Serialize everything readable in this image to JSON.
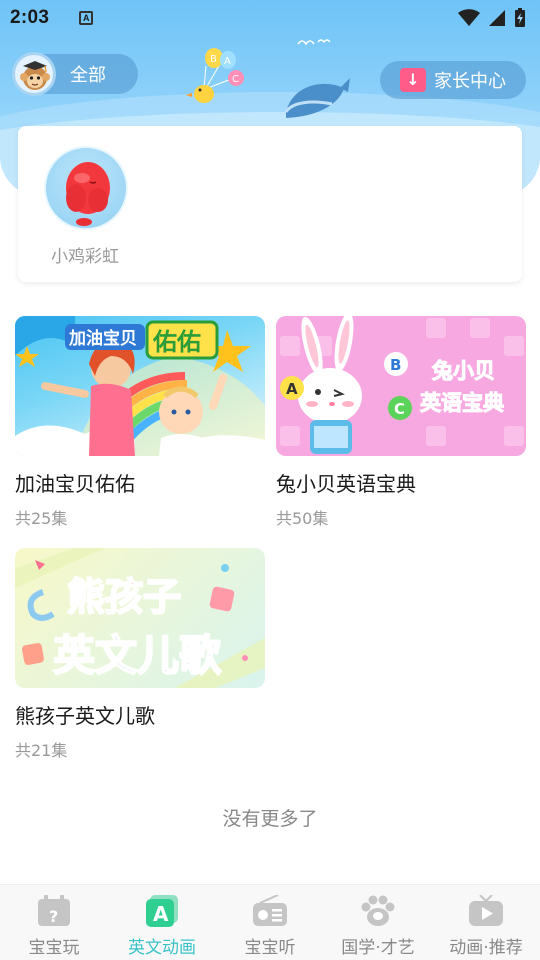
{
  "status_bar": {
    "time": "2:03"
  },
  "header": {
    "filter_label": "全部",
    "parent_center_label": "家长中心"
  },
  "characters": [
    {
      "label": "小鸡彩虹"
    }
  ],
  "shows": [
    {
      "title": "加油宝贝佑佑",
      "count": "共25集",
      "thumb_text_1": "加油宝贝",
      "thumb_text_2": "佑佑"
    },
    {
      "title": "兔小贝英语宝典",
      "count": "共50集",
      "thumb_text_1": "兔小贝",
      "thumb_text_2": "英语宝典"
    },
    {
      "title": "熊孩子英文儿歌",
      "count": "共21集",
      "thumb_text_1": "熊孩子",
      "thumb_text_2": "英文儿歌"
    }
  ],
  "footer_text": "没有更多了",
  "bottom_nav": [
    {
      "label": "宝宝玩",
      "icon": "calendar-question-icon",
      "active": false
    },
    {
      "label": "英文动画",
      "icon": "letter-a-icon",
      "active": true
    },
    {
      "label": "宝宝听",
      "icon": "radio-icon",
      "active": false
    },
    {
      "label": "国学·才艺",
      "icon": "paw-icon",
      "active": false
    },
    {
      "label": "动画·推荐",
      "icon": "tv-play-icon",
      "active": false
    }
  ],
  "colors": {
    "accent": "#39c3c9",
    "sky": "#6fc3f7",
    "download_badge": "#ff5c8a"
  }
}
